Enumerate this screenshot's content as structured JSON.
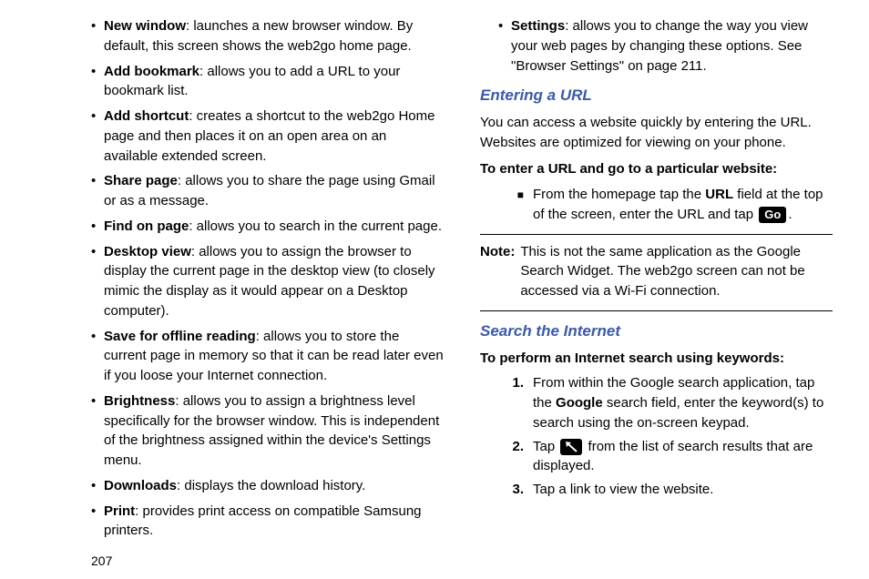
{
  "page_number": "207",
  "left_bullets": [
    {
      "term": "New window",
      "desc": ": launches a new browser window. By default, this screen shows the web2go home page."
    },
    {
      "term": "Add bookmark",
      "desc": ": allows you to add a URL to your bookmark list."
    },
    {
      "term": "Add shortcut",
      "desc": ": creates a shortcut to the web2go Home page and then places it on an open area on an available extended screen."
    },
    {
      "term": "Share page",
      "desc": ": allows you to share the page using Gmail or as a message."
    },
    {
      "term": "Find on page",
      "desc": ": allows you to search in the current page."
    },
    {
      "term": "Desktop view",
      "desc": ": allows you to assign the browser to display the current page in the desktop view (to closely mimic the display as it would appear on a Desktop computer)."
    },
    {
      "term": "Save for offline reading",
      "desc": ": allows you to store the current page in memory so that it can be read later even if you loose your Internet connection."
    },
    {
      "term": "Brightness",
      "desc": ": allows you to assign a brightness level specifically for the browser window. This is independent of the brightness assigned within the device's Settings menu."
    },
    {
      "term": "Downloads",
      "desc": ": displays the download history."
    },
    {
      "term": "Print",
      "desc": ": provides print access on compatible Samsung printers."
    }
  ],
  "right_top_bullet": {
    "term": "Settings",
    "desc": ": allows you to change the way you view your web pages by changing these options. See \"Browser Settings\" on page 211."
  },
  "section1": {
    "heading": "Entering a URL",
    "intro": "You can access a website quickly by entering the URL. Websites are optimized for viewing on your phone.",
    "subhead": "To enter a URL and go to a particular website:",
    "step_pre": "From the homepage tap the ",
    "step_bold": "URL",
    "step_mid": " field at the top of the screen, enter the URL and tap ",
    "step_post": "."
  },
  "go_icon_label": "Go",
  "note": {
    "label": "Note:",
    "text": " This is not the same application as the Google Search Widget. The web2go screen can not be accessed via a Wi-Fi connection."
  },
  "section2": {
    "heading": "Search the Internet",
    "subhead": "To perform an Internet search using keywords:",
    "step1_pre": "From within the Google search application, tap the ",
    "step1_bold": "Google",
    "step1_post": " search field, enter the keyword(s) to search using the on-screen keypad.",
    "step2_pre": "Tap ",
    "step2_post": " from the list of search results that are displayed.",
    "step3": "Tap a link to view the website."
  }
}
